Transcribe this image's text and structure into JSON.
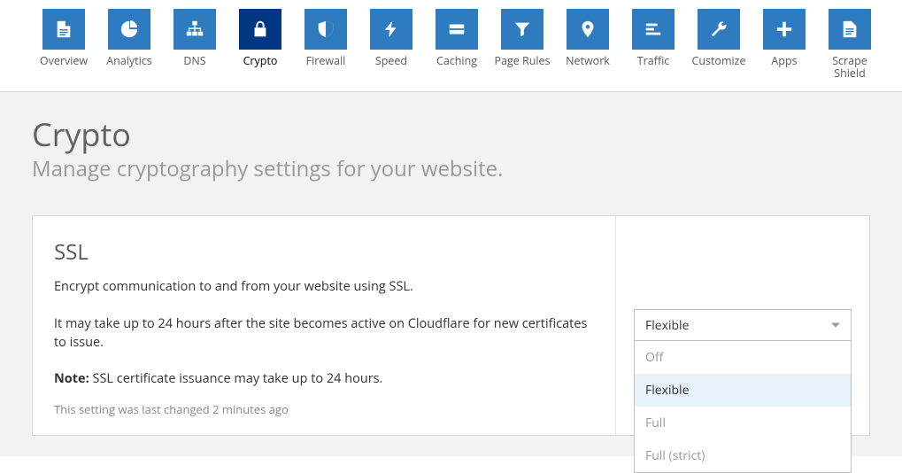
{
  "nav": [
    {
      "key": "overview",
      "label": "Overview",
      "icon": "file"
    },
    {
      "key": "analytics",
      "label": "Analytics",
      "icon": "pie"
    },
    {
      "key": "dns",
      "label": "DNS",
      "icon": "sitemap"
    },
    {
      "key": "crypto",
      "label": "Crypto",
      "icon": "lock",
      "active": true
    },
    {
      "key": "firewall",
      "label": "Firewall",
      "icon": "shield"
    },
    {
      "key": "speed",
      "label": "Speed",
      "icon": "bolt"
    },
    {
      "key": "caching",
      "label": "Caching",
      "icon": "drive"
    },
    {
      "key": "page-rules",
      "label": "Page Rules",
      "icon": "filter"
    },
    {
      "key": "network",
      "label": "Network",
      "icon": "pin"
    },
    {
      "key": "traffic",
      "label": "Traffic",
      "icon": "list"
    },
    {
      "key": "customize",
      "label": "Customize",
      "icon": "wrench"
    },
    {
      "key": "apps",
      "label": "Apps",
      "icon": "plus"
    },
    {
      "key": "scrape-shield",
      "label": "Scrape Shield",
      "icon": "doc",
      "wrap": true
    }
  ],
  "page": {
    "title": "Crypto",
    "subtitle": "Manage cryptography settings for your website."
  },
  "ssl": {
    "title": "SSL",
    "desc": "Encrypt communication to and from your website using SSL.",
    "timing": "It may take up to 24 hours after the site becomes active on Cloudflare for new certificates to issue.",
    "note_label": "Note:",
    "note_text": " SSL certificate issuance may take up to 24 hours.",
    "meta": "This setting was last changed 2 minutes ago",
    "selected": "Flexible",
    "options": [
      "Off",
      "Flexible",
      "Full",
      "Full (strict)"
    ]
  }
}
